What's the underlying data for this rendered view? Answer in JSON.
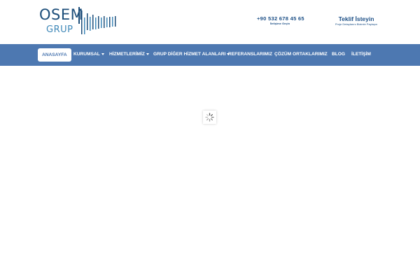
{
  "header": {
    "logo": {
      "line1": "OSEM",
      "line2": "GRUP"
    },
    "phone": {
      "number": "+90 532 678 45 65",
      "caption": "İletişime Geçin"
    },
    "quote": {
      "title": "Teklif İsteyin",
      "caption": "Proje Detaylarını Bizimle Paylaşın"
    }
  },
  "nav": {
    "items": [
      {
        "label": "ANASAYFA",
        "active": true,
        "dropdown": false
      },
      {
        "label": "KURUMSAL",
        "active": false,
        "dropdown": true
      },
      {
        "label": "HİZMETLERİMİZ",
        "active": false,
        "dropdown": true
      },
      {
        "label": "GRUP DİĞER HİZMET ALANLARI",
        "active": false,
        "dropdown": true
      },
      {
        "label": "REFERANSLARIMIZ",
        "active": false,
        "dropdown": false
      },
      {
        "label": "ÇÖZÜM ORTAKLARIMIZ",
        "active": false,
        "dropdown": false
      },
      {
        "label": "BLOG",
        "active": false,
        "dropdown": false
      },
      {
        "label": "İLETİŞİM",
        "active": false,
        "dropdown": false
      }
    ]
  },
  "colors": {
    "nav_background": "#4d78b1",
    "logo_dark_blue": "#1d4e7a",
    "logo_light_blue": "#3f88b8",
    "text_dark_blue": "#1c4f86",
    "page_background": "#ffffff"
  },
  "loader": {
    "icon": "spinner-icon"
  }
}
